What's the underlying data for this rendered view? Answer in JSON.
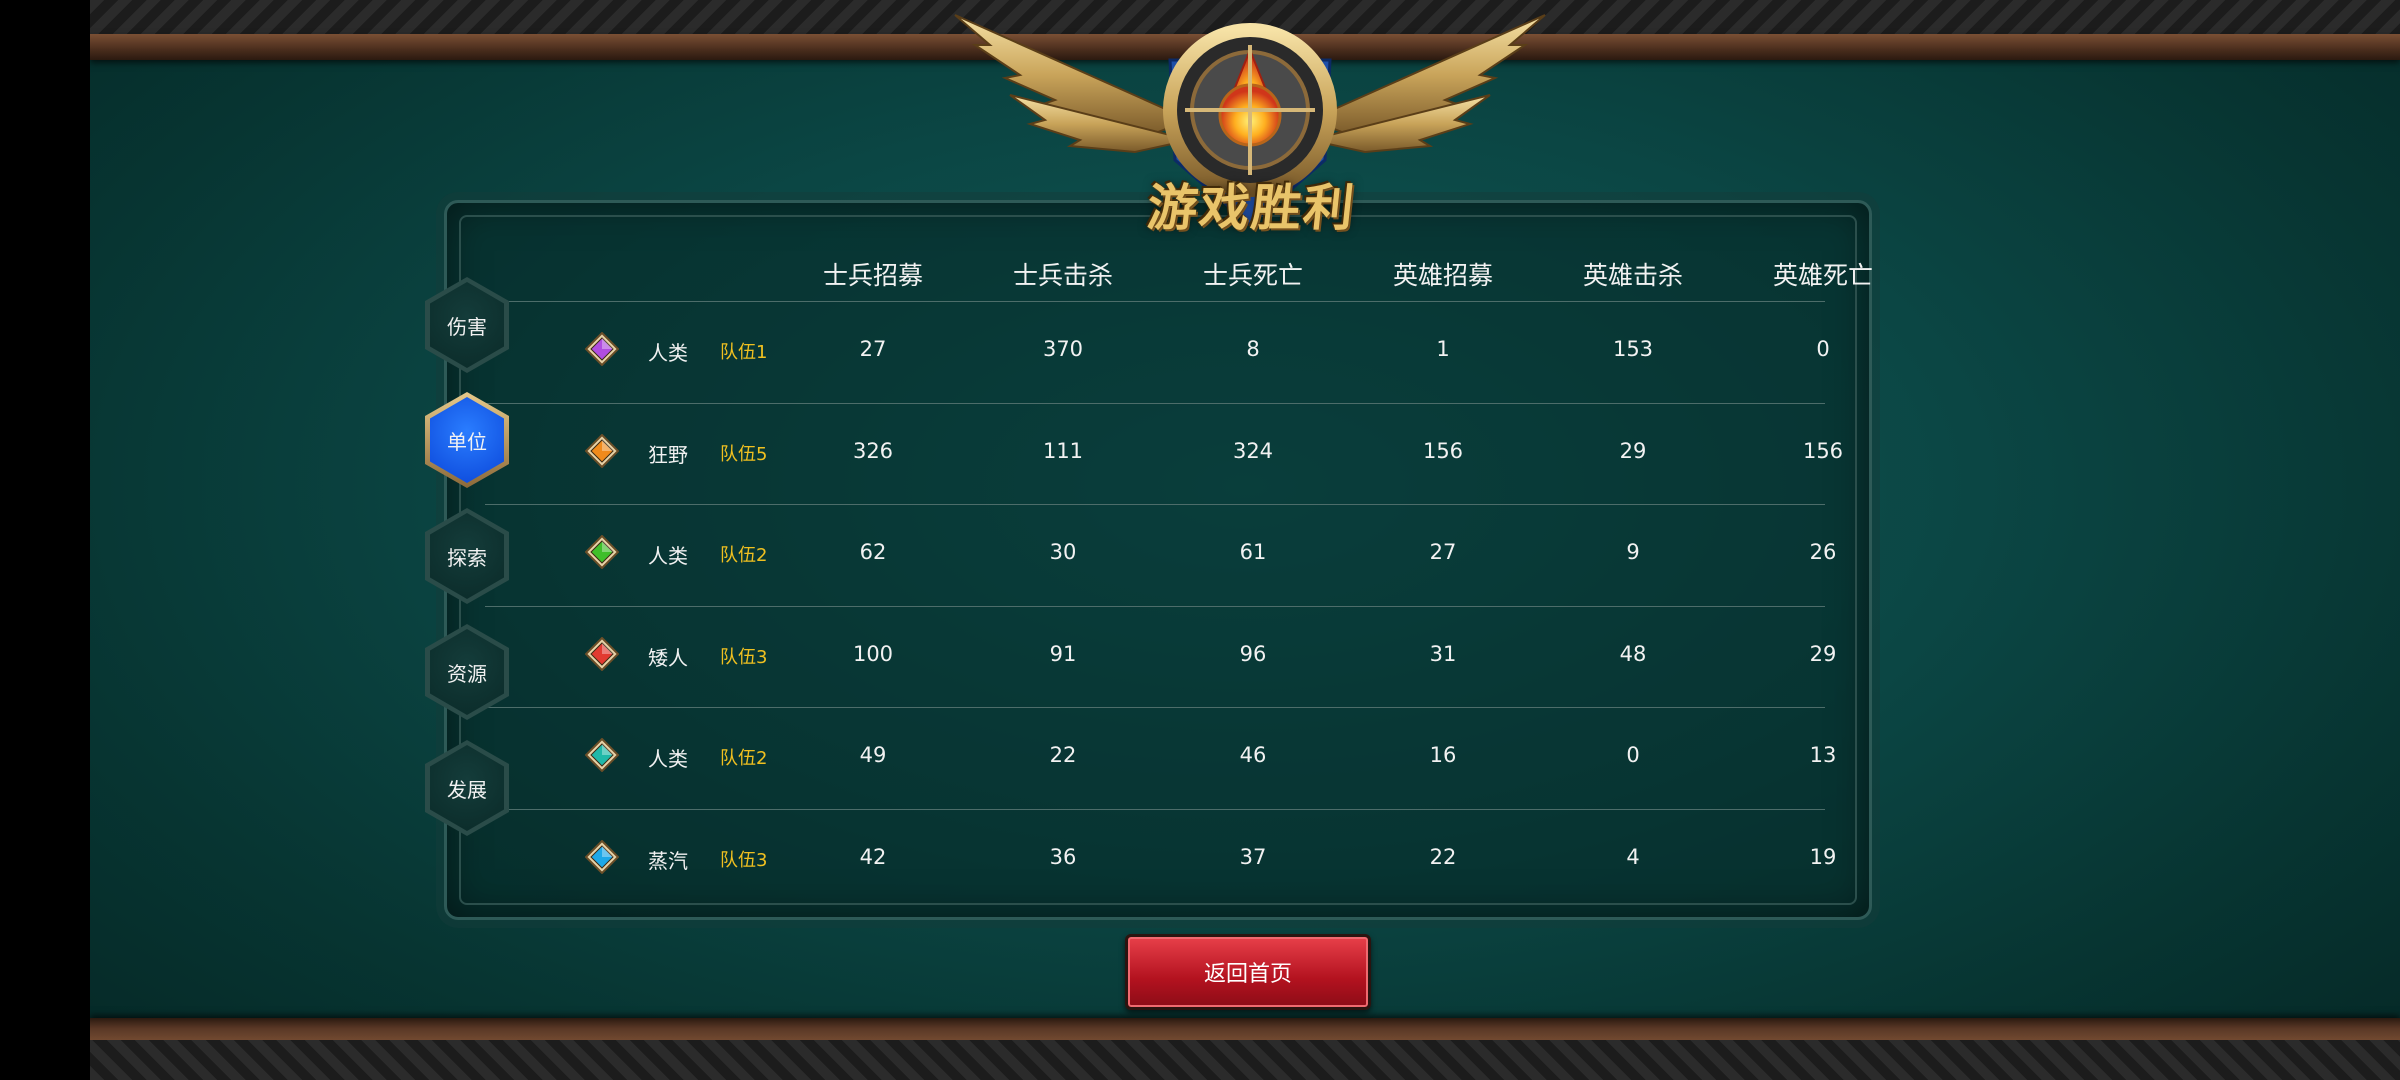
{
  "title": "游戏胜利",
  "tabs": [
    {
      "label": "伤害",
      "active": false
    },
    {
      "label": "单位",
      "active": true
    },
    {
      "label": "探索",
      "active": false
    },
    {
      "label": "资源",
      "active": false
    },
    {
      "label": "发展",
      "active": false
    }
  ],
  "table": {
    "columns": [
      "士兵招募",
      "士兵击杀",
      "士兵死亡",
      "英雄招募",
      "英雄击杀",
      "英雄死亡"
    ],
    "rows": [
      {
        "gem_color": "#b04de0",
        "race": "人类",
        "team": "队伍1",
        "values": [
          "27",
          "370",
          "8",
          "1",
          "153",
          "0"
        ]
      },
      {
        "gem_color": "#f08a1c",
        "race": "狂野",
        "team": "队伍5",
        "values": [
          "326",
          "111",
          "324",
          "156",
          "29",
          "156"
        ]
      },
      {
        "gem_color": "#3fbf2a",
        "race": "人类",
        "team": "队伍2",
        "values": [
          "62",
          "30",
          "61",
          "27",
          "9",
          "26"
        ]
      },
      {
        "gem_color": "#e23a30",
        "race": "矮人",
        "team": "队伍3",
        "values": [
          "100",
          "91",
          "96",
          "31",
          "48",
          "29"
        ]
      },
      {
        "gem_color": "#20b8a8",
        "race": "人类",
        "team": "队伍2",
        "values": [
          "49",
          "22",
          "46",
          "16",
          "0",
          "13"
        ]
      },
      {
        "gem_color": "#1ea8e8",
        "race": "蒸汽",
        "team": "队伍3",
        "values": [
          "42",
          "36",
          "37",
          "22",
          "4",
          "19"
        ]
      }
    ]
  },
  "button": {
    "home_label": "返回首页"
  },
  "colors": {
    "team_text": "#f0c020",
    "active_tab": "#1a5cff",
    "button": "#c8202c"
  }
}
